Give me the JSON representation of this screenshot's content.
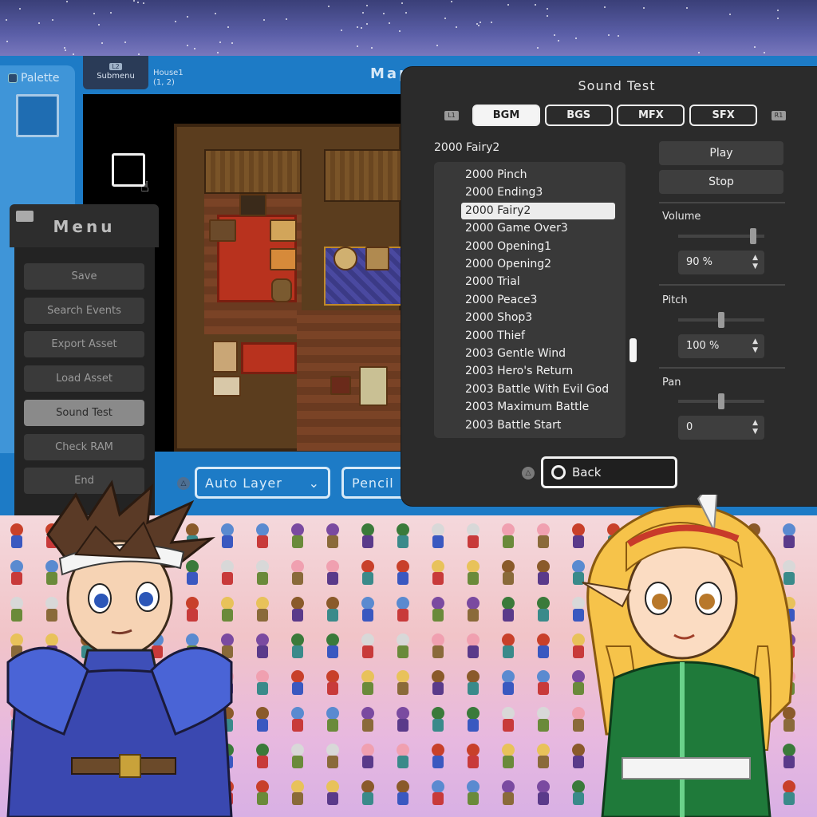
{
  "palette": {
    "label": "Palette"
  },
  "submenu": {
    "tag": "L2",
    "label": "Submenu"
  },
  "map": {
    "name": "House1",
    "coords": "(1, 2)",
    "title": "Map"
  },
  "toolbar": {
    "layer_mode": "Auto Layer",
    "tool": "Pencil"
  },
  "menu": {
    "title": "Menu",
    "items": [
      {
        "label": "Save"
      },
      {
        "label": "Search Events"
      },
      {
        "label": "Export Asset"
      },
      {
        "label": "Load Asset"
      },
      {
        "label": "Sound Test",
        "active": true
      },
      {
        "label": "Check RAM"
      },
      {
        "label": "End"
      }
    ]
  },
  "sound_test": {
    "title": "Sound Test",
    "left_bumper": "L1",
    "right_bumper": "R1",
    "tabs": [
      {
        "label": "BGM",
        "active": true
      },
      {
        "label": "BGS"
      },
      {
        "label": "MFX"
      },
      {
        "label": "SFX"
      }
    ],
    "current_track": "2000 Fairy2",
    "tracks": [
      "2000 Pinch",
      "2000 Ending3",
      "2000 Fairy2",
      "2000 Game Over3",
      "2000 Opening1",
      "2000 Opening2",
      "2000 Trial",
      "2000 Peace3",
      "2000 Shop3",
      "2000 Thief",
      "2003 Gentle Wind",
      "2003 Hero's Return",
      "2003 Battle With Evil God",
      "2003 Maximum Battle",
      "2003 Battle Start"
    ],
    "selected_index": 2,
    "play_label": "Play",
    "stop_label": "Stop",
    "volume": {
      "label": "Volume",
      "value": "90 %",
      "level": 0.9
    },
    "pitch": {
      "label": "Pitch",
      "value": "100 %",
      "level": 0.5
    },
    "pan": {
      "label": "Pan",
      "value": "0",
      "level": 0.5
    },
    "back_label": "Back"
  },
  "colors": {
    "editor_blue": "#1d7bc6",
    "dialog_bg": "#2b2b2b",
    "menu_bg": "#232323"
  }
}
